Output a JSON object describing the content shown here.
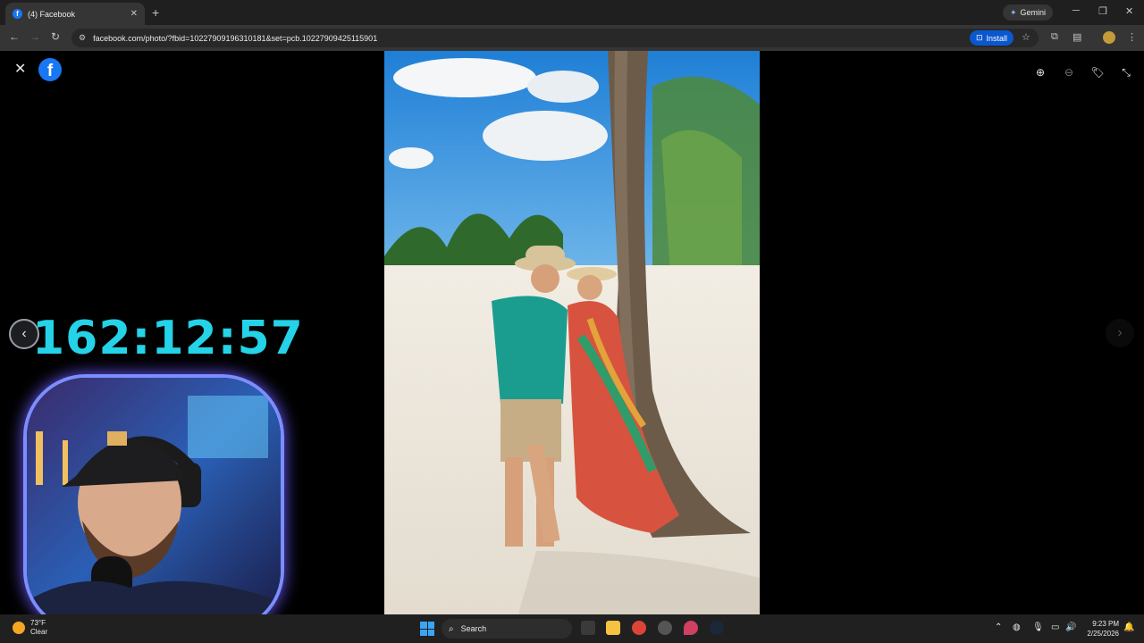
{
  "browser": {
    "tab_title": "(4) Facebook",
    "favicon_letter": "f",
    "gemini_label": "Gemini",
    "url": "facebook.com/photo/?fbid=10227909196310181&set=pcb.10227909425115901",
    "install_label": "Install"
  },
  "viewer": {
    "logo_letter": "f",
    "timer": "162:12:57"
  },
  "taskbar": {
    "weather_temp": "73°F",
    "weather_cond": "Clear",
    "search_label": "Search",
    "time": "9:23 PM",
    "date": "2/25/2026"
  },
  "colors": {
    "accent_blue": "#1877f2",
    "timer_cyan": "#24d3e8",
    "install_blue": "#0b57d0"
  }
}
